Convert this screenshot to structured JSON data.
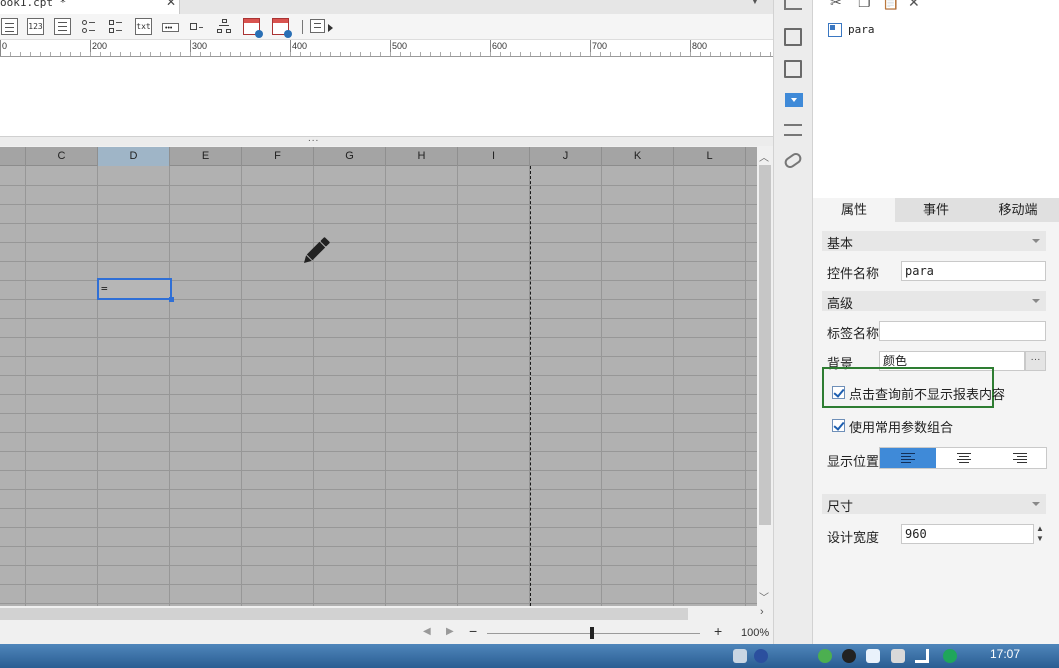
{
  "document_tab": {
    "title": "ook1.cpt *",
    "close": "✕"
  },
  "toolbar": {
    "icons": [
      "calendar-icon",
      "number-field-icon",
      "text-area-icon",
      "radio-group-icon",
      "checkbox-group-icon",
      "text-field-icon",
      "password-icon",
      "checkbox-icon",
      "tree-combo-icon",
      "date-icon",
      "datetime-icon",
      "more-widgets-icon"
    ],
    "number_field_text": "123",
    "text_field_text": "txt"
  },
  "ruler": {
    "labels": [
      "0",
      "200",
      "300",
      "400",
      "500",
      "600",
      "700",
      "800"
    ]
  },
  "splitter": {
    "grip": "..."
  },
  "grid": {
    "columns": [
      "C",
      "D",
      "E",
      "F",
      "G",
      "H",
      "I",
      "J",
      "K",
      "L"
    ],
    "selected_column": "D",
    "selected_cell_text": "="
  },
  "status": {
    "zoom": "100%",
    "minus": "−",
    "plus": "+"
  },
  "widget_tree": {
    "root_label": "para"
  },
  "properties": {
    "tabs": [
      "属性",
      "事件",
      "移动端"
    ],
    "active_tab": "属性",
    "section_basic": "基本",
    "widget_name_label": "控件名称",
    "widget_name_value": "para",
    "section_advanced": "高级",
    "tag_name_label": "标签名称",
    "tag_name_value": "",
    "background_label": "背景",
    "background_value": "颜色",
    "ellipsis": "···",
    "checkbox_hide_before_query": "点击查询前不显示报表内容",
    "checkbox_common_param_combo": "使用常用参数组合",
    "display_position_label": "显示位置",
    "section_size": "尺寸",
    "design_width_label": "设计宽度",
    "design_width_value": "960"
  },
  "taskbar": {
    "time": "17:07"
  },
  "colors": {
    "accent": "#3f8ad8",
    "highlight": "#2e7d32",
    "grid_bg": "#b1b1b1",
    "selected": "#2f6fd6"
  }
}
